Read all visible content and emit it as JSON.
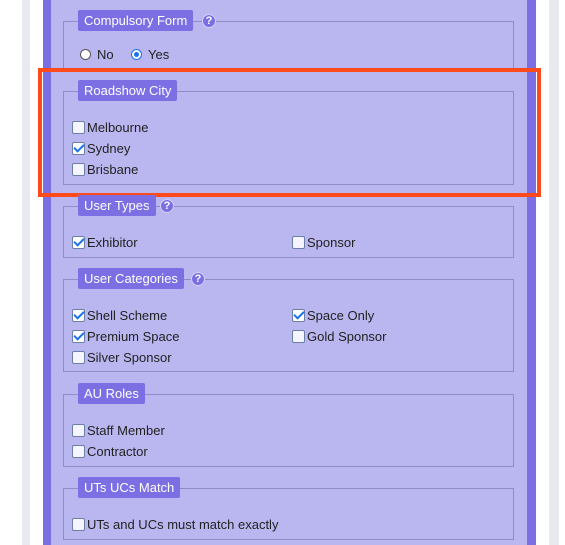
{
  "compulsory_form": {
    "legend": "Compulsory Form",
    "options": [
      {
        "label": "No",
        "selected": false
      },
      {
        "label": "Yes",
        "selected": true
      }
    ]
  },
  "roadshow_city": {
    "legend": "Roadshow City",
    "options": [
      {
        "label": "Melbourne",
        "checked": false
      },
      {
        "label": "Sydney",
        "checked": true
      },
      {
        "label": "Brisbane",
        "checked": false
      }
    ]
  },
  "user_types": {
    "legend": "User Types",
    "options": [
      {
        "label": "Exhibitor",
        "checked": true
      },
      {
        "label": "Sponsor",
        "checked": false
      }
    ]
  },
  "user_categories": {
    "legend": "User Categories",
    "options": [
      {
        "label": "Shell Scheme",
        "checked": true
      },
      {
        "label": "Space Only",
        "checked": true
      },
      {
        "label": "Premium Space",
        "checked": true
      },
      {
        "label": "Gold Sponsor",
        "checked": false
      },
      {
        "label": "Silver Sponsor",
        "checked": false
      }
    ]
  },
  "au_roles": {
    "legend": "AU Roles",
    "options": [
      {
        "label": "Staff Member",
        "checked": false
      },
      {
        "label": "Contractor",
        "checked": false
      }
    ]
  },
  "uts_ucs_match": {
    "legend": "UTs UCs Match",
    "options": [
      {
        "label": "UTs and UCs must match exactly",
        "checked": false
      }
    ]
  },
  "help_glyph": "?",
  "colors": {
    "panel": "#7b6fe3",
    "panel_inner": "#bab6f0",
    "highlight": "#ff4a1c",
    "check": "#1a73e8"
  }
}
